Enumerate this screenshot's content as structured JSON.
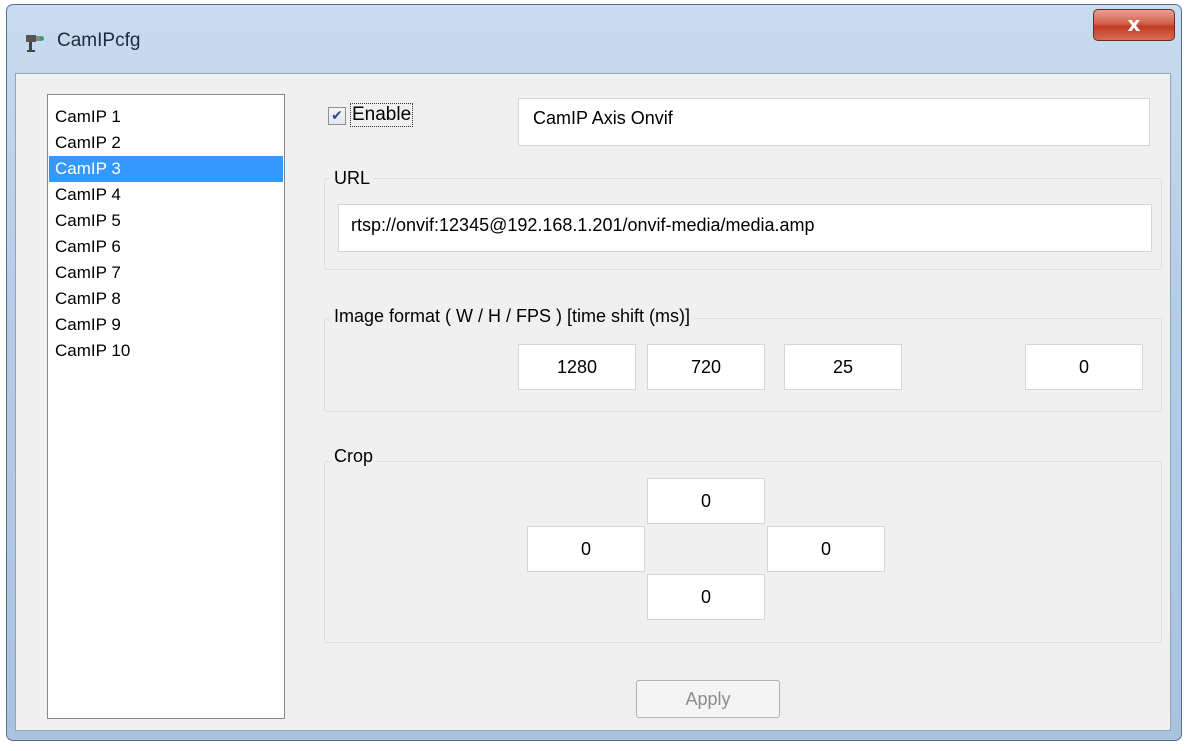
{
  "window": {
    "title": "CamIPcfg",
    "app_icon": "camera-icon",
    "close_icon": "close-icon",
    "close_label": "x"
  },
  "camera_list": {
    "items": [
      "CamIP 1",
      "CamIP 2",
      "CamIP 3",
      "CamIP 4",
      "CamIP 5",
      "CamIP 6",
      "CamIP 7",
      "CamIP 8",
      "CamIP 9",
      "CamIP 10"
    ],
    "selected_index": 2
  },
  "enable": {
    "label": "Enable",
    "checked": true
  },
  "name_field": {
    "value": "CamIP Axis Onvif"
  },
  "url_group": {
    "label": "URL",
    "value": "rtsp://onvif:12345@192.168.1.201/onvif-media/media.amp"
  },
  "image_format": {
    "label": "Image format ( W / H / FPS ) [time shift (ms)]",
    "width": "1280",
    "height": "720",
    "fps": "25",
    "time_shift": "0"
  },
  "crop": {
    "label": "Crop",
    "top": "0",
    "left": "0",
    "right": "0",
    "bottom": "0"
  },
  "apply": {
    "label": "Apply",
    "enabled": false
  },
  "colors": {
    "selection": "#3399ff",
    "close_button": "#c8452e"
  }
}
